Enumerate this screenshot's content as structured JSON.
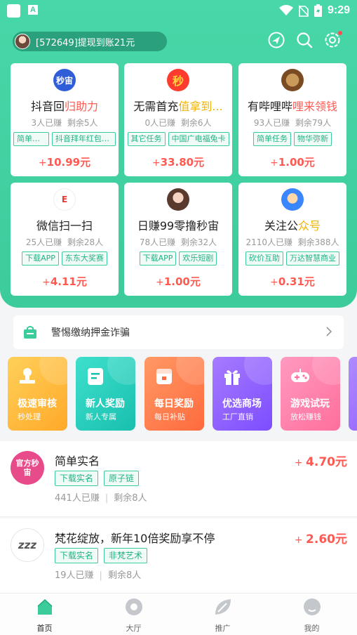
{
  "status_bar": {
    "time": "9:29",
    "app_badge": "A"
  },
  "header": {
    "notice_text": "[572649]提现到账21元",
    "icons": [
      "location-share-icon",
      "search-icon",
      "settings-icon"
    ]
  },
  "task_cards": [
    {
      "icon_text": "秒宙",
      "title_pre": "抖音回",
      "title_hl": "归助力",
      "earned": "3人已赚",
      "remaining": "剩余5人",
      "tags": [
        "简单任务",
        "抖音拜年红包助..."
      ],
      "reward_prefix": "+",
      "reward": "10.99元"
    },
    {
      "icon_text": "秒",
      "title_pre": "无需首充",
      "title_hl": "值拿到...",
      "earned": "0人已赚",
      "remaining": "剩余6人",
      "tags": [
        "其它任务",
        "中国广电福兔卡"
      ],
      "reward_prefix": "+",
      "reward": "33.80元"
    },
    {
      "icon_text": "",
      "title_pre": "有哔哩哔",
      "title_hl": "哩来领钱",
      "earned": "93人已赚",
      "remaining": "剩余79人",
      "tags": [
        "简单任务",
        "物华弥新"
      ],
      "reward_prefix": "+",
      "reward": "1.00元"
    },
    {
      "icon_text": "E",
      "title_pre": "微信扫一扫",
      "title_hl": "",
      "earned": "25人已赚",
      "remaining": "剩余28人",
      "tags": [
        "下载APP",
        "东东大奖赛"
      ],
      "reward_prefix": "+",
      "reward": "4.11元"
    },
    {
      "icon_text": "",
      "title_pre": "日赚99零撸秒宙",
      "title_hl": "",
      "earned": "78人已赚",
      "remaining": "剩余32人",
      "tags": [
        "下载APP",
        "欢乐短剧"
      ],
      "reward_prefix": "+",
      "reward": "1.00元"
    },
    {
      "icon_text": "",
      "title_pre": "关注公",
      "title_hl": "众号",
      "earned": "2110人已赚",
      "remaining": "剩余388人",
      "tags": [
        "砍价互助",
        "万达智慧商业"
      ],
      "reward_prefix": "+",
      "reward": "0.31元"
    }
  ],
  "warning": {
    "text": "警惕缴纳押金诈骗"
  },
  "categories": [
    {
      "title": "极速审核",
      "subtitle": "秒处理",
      "color_from": "#ffc64a",
      "color_to": "#ffa928",
      "icon": "stamp-icon"
    },
    {
      "title": "新人奖励",
      "subtitle": "新人专属",
      "color_from": "#33d6c4",
      "color_to": "#1bbfb0",
      "icon": "document-icon"
    },
    {
      "title": "每日奖励",
      "subtitle": "每日补贴",
      "color_from": "#ff8a5c",
      "color_to": "#ff6a3d",
      "icon": "calendar-icon"
    },
    {
      "title": "优选商场",
      "subtitle": "工厂直销",
      "color_from": "#9b6bff",
      "color_to": "#7c4dff",
      "icon": "gift-icon"
    },
    {
      "title": "游戏试玩",
      "subtitle": "放松赚钱",
      "color_from": "#ff8fb5",
      "color_to": "#ff6f9c",
      "icon": "gamepad-icon"
    }
  ],
  "task_list": [
    {
      "avatar_text": "官方秒宙",
      "title": "简单实名",
      "tags": [
        "下载实名",
        "原子链"
      ],
      "earned": "441人已赚",
      "remaining": "剩余8人",
      "reward_prefix": "+",
      "reward": "4.70元"
    },
    {
      "avatar_text": "zzz",
      "title": "梵花绽放，新年10倍奖励享不停",
      "tags": [
        "下载实名",
        "非梵艺术"
      ],
      "earned": "19人已赚",
      "remaining": "剩余8人",
      "reward_prefix": "+",
      "reward": "2.60元"
    }
  ],
  "bottom_nav": [
    {
      "label": "首页",
      "active": true
    },
    {
      "label": "大厅",
      "active": false
    },
    {
      "label": "推广",
      "active": false
    },
    {
      "label": "我的",
      "active": false
    }
  ]
}
